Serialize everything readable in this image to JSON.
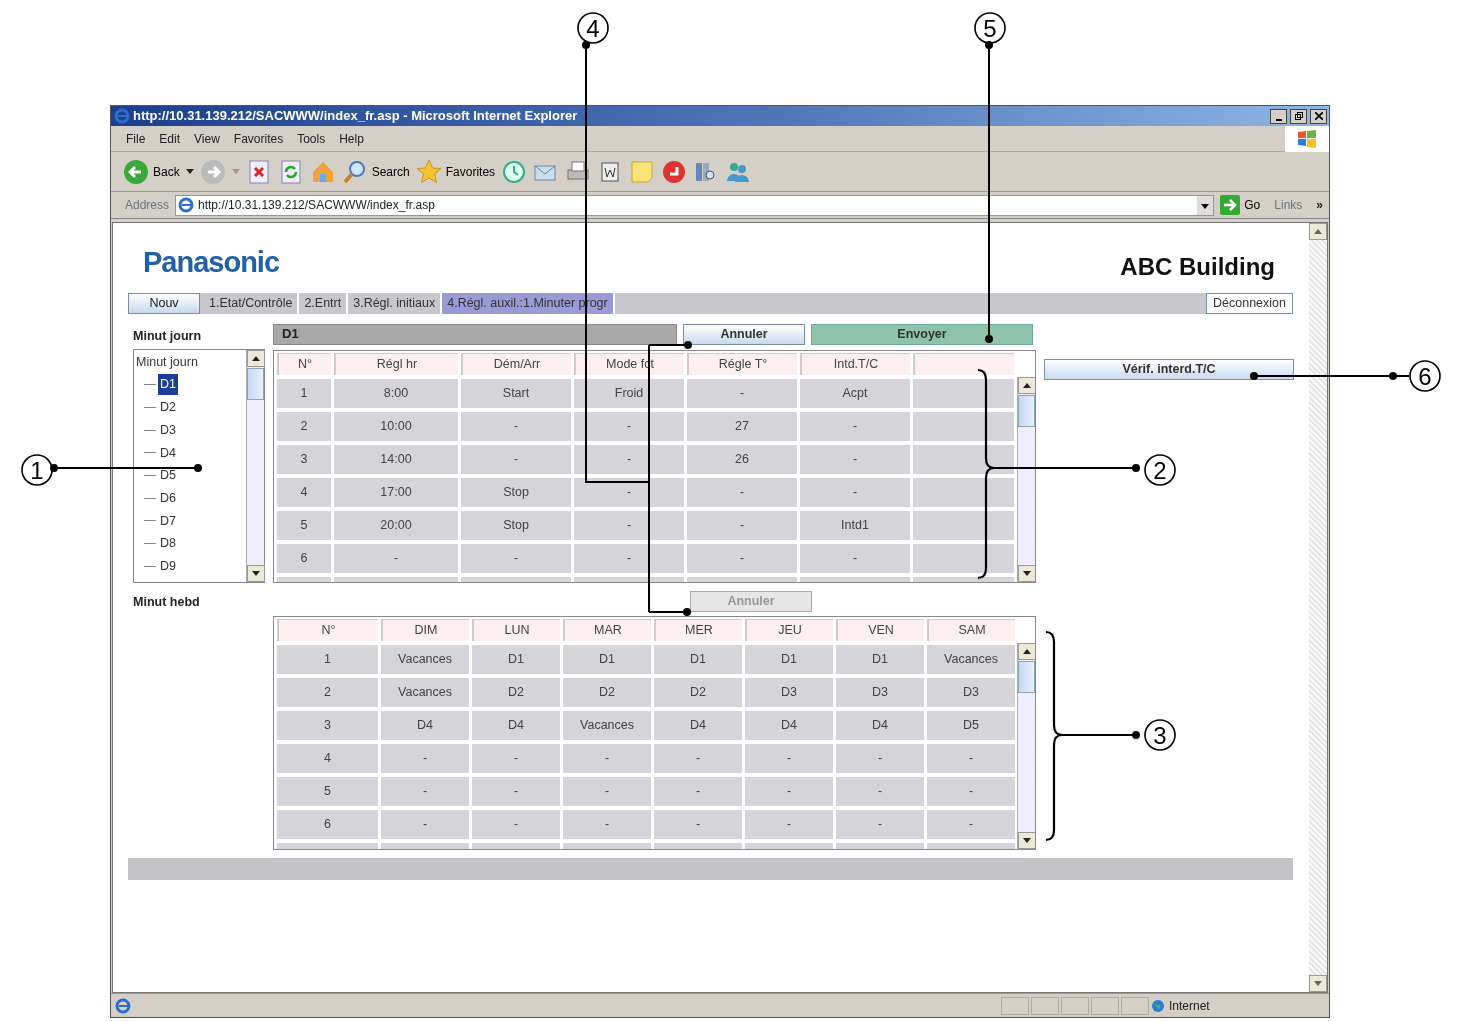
{
  "window": {
    "title": "http://10.31.139.212/SACWWW/index_fr.asp - Microsoft Internet Explorer"
  },
  "menu": [
    "File",
    "Edit",
    "View",
    "Favorites",
    "Tools",
    "Help"
  ],
  "toolbar": [
    {
      "label": "Back"
    },
    {
      "label": "Search"
    },
    {
      "label": "Favorites"
    }
  ],
  "address_bar": {
    "label": "Address",
    "value": "http://10.31.139.212/SACWWW/index_fr.asp",
    "go": "Go",
    "links": "Links",
    "more": "»"
  },
  "page": {
    "logo": "Panasonic",
    "building": "ABC Building",
    "new_button": "Nouv",
    "tabs": [
      {
        "label": "1.Etat/Contrôle",
        "selected": false
      },
      {
        "label": "2.Entrt",
        "selected": false
      },
      {
        "label": "3.Régl. initiaux",
        "selected": false
      },
      {
        "label": "4.Régl. auxil.:1.Minuter progr",
        "selected": true
      }
    ],
    "logout_button": "Déconnexion",
    "daily": {
      "label": "Minut journ",
      "tree": {
        "label": "Minut journ",
        "children": [
          {
            "label": "D1",
            "selected": true
          },
          {
            "label": "D2",
            "selected": false
          },
          {
            "label": "D3",
            "selected": false
          },
          {
            "label": "D4",
            "selected": false
          },
          {
            "label": "D5",
            "selected": false
          },
          {
            "label": "D6",
            "selected": false
          },
          {
            "label": "D7",
            "selected": false
          },
          {
            "label": "D8",
            "selected": false
          },
          {
            "label": "D9",
            "selected": false
          }
        ]
      },
      "header": "D1",
      "cancel": {
        "label": "Annuler",
        "disabled": false
      },
      "send": "Envoyer",
      "columns": [
        "N°",
        "Régl hr",
        "Dém/Arr",
        "Mode fct",
        "Régle T°",
        "Intd.T/C"
      ],
      "rows": [
        [
          "1",
          "8:00",
          "Start",
          "Froid",
          "-",
          "Acpt"
        ],
        [
          "2",
          "10:00",
          "-",
          "-",
          "27",
          "-"
        ],
        [
          "3",
          "14:00",
          "-",
          "-",
          "26",
          "-"
        ],
        [
          "4",
          "17:00",
          "Stop",
          "-",
          "-",
          "-"
        ],
        [
          "5",
          "20:00",
          "Stop",
          "-",
          "-",
          "Intd1"
        ],
        [
          "6",
          "-",
          "-",
          "-",
          "-",
          "-"
        ]
      ]
    },
    "verify_button": "Vérif. interd.T/C",
    "weekly": {
      "label": "Minut hebd",
      "cancel": {
        "label": "Annuler",
        "disabled": true
      },
      "columns": [
        "N°",
        "DIM",
        "LUN",
        "MAR",
        "MER",
        "JEU",
        "VEN",
        "SAM"
      ],
      "rows": [
        [
          "1",
          "Vacances",
          "D1",
          "D1",
          "D1",
          "D1",
          "D1",
          "Vacances"
        ],
        [
          "2",
          "Vacances",
          "D2",
          "D2",
          "D2",
          "D3",
          "D3",
          "D3"
        ],
        [
          "3",
          "D4",
          "D4",
          "Vacances",
          "D4",
          "D4",
          "D4",
          "D5"
        ],
        [
          "4",
          "-",
          "-",
          "-",
          "-",
          "-",
          "-",
          "-"
        ],
        [
          "5",
          "-",
          "-",
          "-",
          "-",
          "-",
          "-",
          "-"
        ],
        [
          "6",
          "-",
          "-",
          "-",
          "-",
          "-",
          "-",
          "-"
        ]
      ]
    }
  },
  "status_bar": {
    "zone": "Internet"
  },
  "callouts": [
    "1",
    "2",
    "3",
    "4",
    "5",
    "6"
  ]
}
